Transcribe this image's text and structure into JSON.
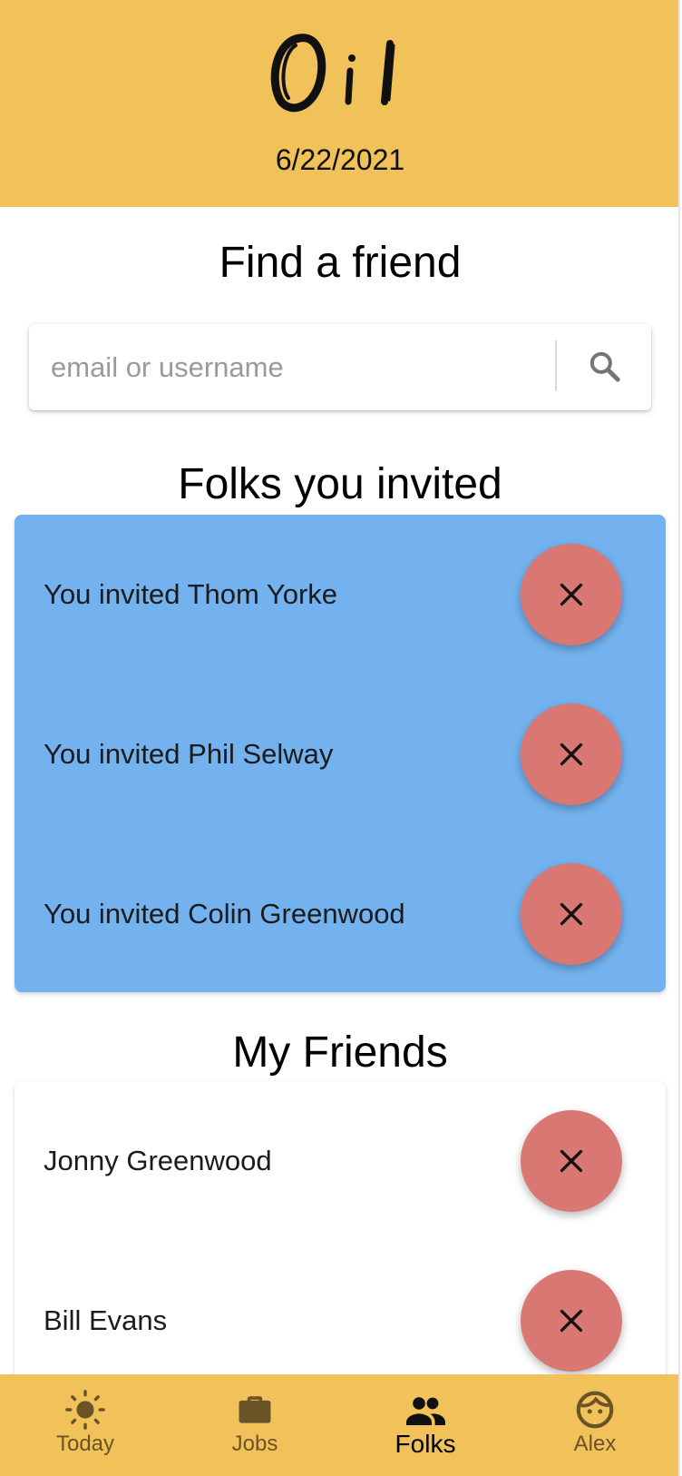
{
  "header": {
    "logo_text": "Oil",
    "date": "6/22/2021"
  },
  "find_friend": {
    "title": "Find a friend",
    "placeholder": "email or username",
    "value": ""
  },
  "invited": {
    "title": "Folks you invited",
    "items": [
      {
        "label": "You invited Thom Yorke"
      },
      {
        "label": "You invited Phil Selway"
      },
      {
        "label": "You invited Colin Greenwood"
      }
    ]
  },
  "friends": {
    "title": "My Friends",
    "items": [
      {
        "label": "Jonny Greenwood"
      },
      {
        "label": "Bill Evans"
      }
    ]
  },
  "nav": {
    "items": [
      {
        "label": "Today",
        "icon": "sun-icon"
      },
      {
        "label": "Jobs",
        "icon": "briefcase-icon"
      },
      {
        "label": "Folks",
        "icon": "people-icon",
        "active": true
      },
      {
        "label": "Alex",
        "icon": "face-icon"
      }
    ]
  },
  "colors": {
    "brand_yellow": "#f1c15a",
    "invited_blue": "#74b2ef",
    "remove_red": "#d97773",
    "nav_inactive": "#6b5328"
  }
}
